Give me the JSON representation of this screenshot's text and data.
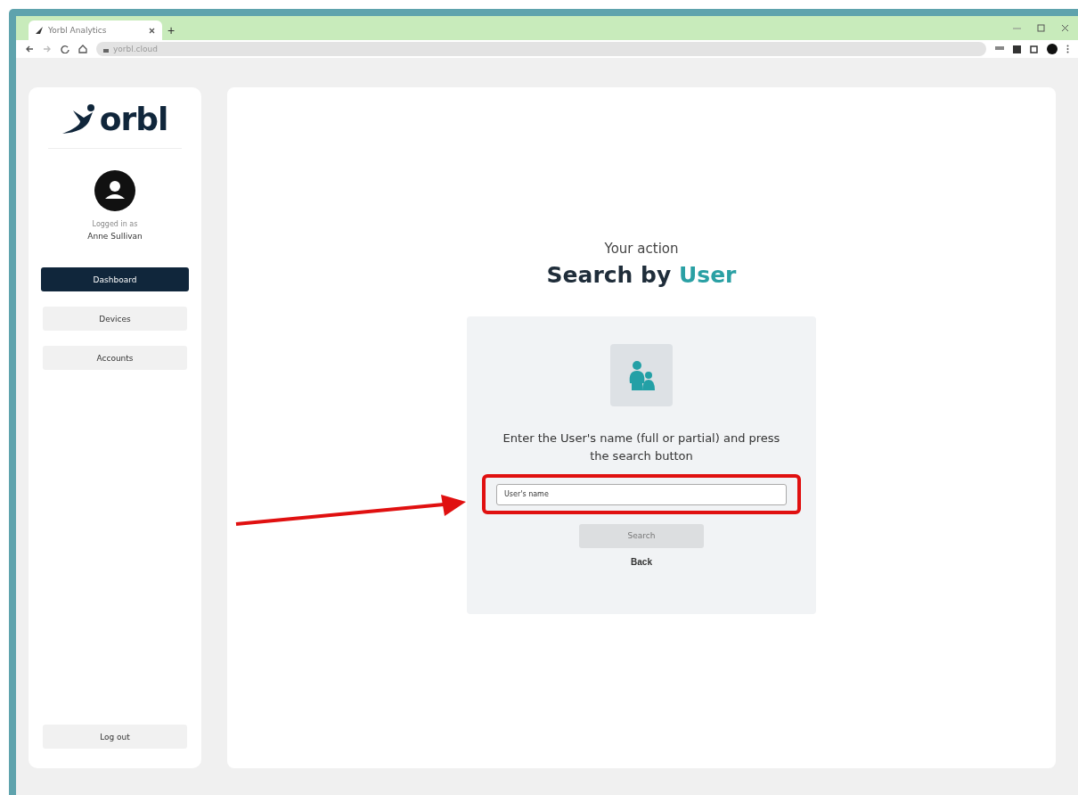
{
  "browser": {
    "tab_title": "Yorbl Analytics",
    "new_tab": "+",
    "url": "yorbl.cloud"
  },
  "sidebar": {
    "logo_text": "orbl",
    "user": {
      "caption": "Logged in as",
      "name": "Anne Sullivan"
    },
    "nav": [
      {
        "label": "Dashboard",
        "selected": true
      },
      {
        "label": "Devices",
        "selected": false
      },
      {
        "label": "Accounts",
        "selected": false
      }
    ],
    "logout": "Log out"
  },
  "main": {
    "eyebrow": "Your action",
    "title": "Search by **User**",
    "instruction": "Enter the User's name (full or partial) and press the search button",
    "field": {
      "placeholder": "User's name",
      "highlighted": true
    },
    "search_button": {
      "label": "Search",
      "disabled": true
    },
    "back": "Back"
  }
}
